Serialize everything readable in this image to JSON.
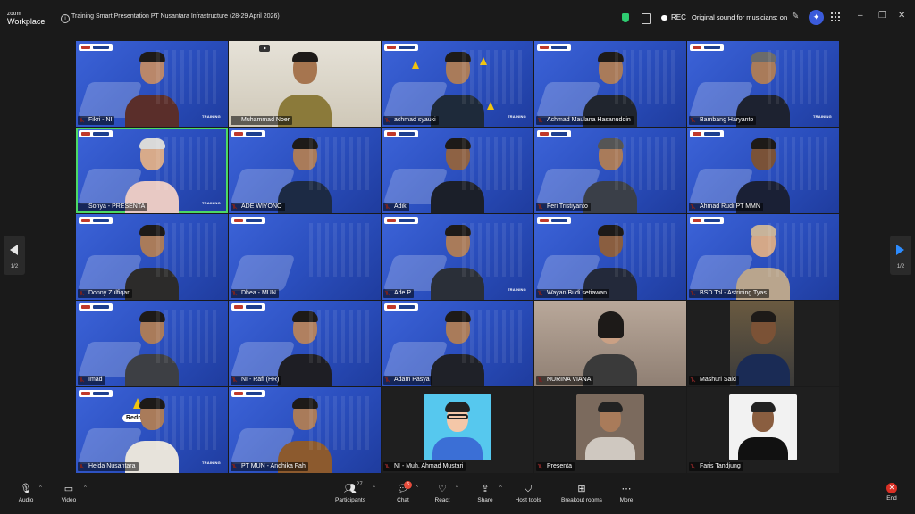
{
  "app": {
    "logo_line1": "zoom",
    "logo_line2": "Workplace",
    "meeting_title": "Training Smart Presentation PT Nusantara Infrastructure (28-29 April 2026)"
  },
  "topbar": {
    "rec_label": "REC",
    "original_sound": "Original sound for musicians: on"
  },
  "gallery": {
    "page_indicator": "1/2",
    "training_label": "TRAINING",
    "redmi_label": "Redmi N...",
    "participants": [
      {
        "name": "Fikri - NI"
      },
      {
        "name": "Muhammad Noer"
      },
      {
        "name": "achmad syauki"
      },
      {
        "name": "Achmad Maulana Hasanuddin"
      },
      {
        "name": "Bambang Haryanto"
      },
      {
        "name": "Sonya - PRESENTA"
      },
      {
        "name": "ADE WIYONO"
      },
      {
        "name": "Adik"
      },
      {
        "name": "Feri Tristiyanto"
      },
      {
        "name": "Ahmad Rudi PT MMN"
      },
      {
        "name": "Donny Zulfiqar"
      },
      {
        "name": "Dhea - MUN"
      },
      {
        "name": "Ade P"
      },
      {
        "name": "Wayan Budi setiawan"
      },
      {
        "name": "BSD Tol - Astrining Tyas"
      },
      {
        "name": "Imad"
      },
      {
        "name": "NI - Rafi (HR)"
      },
      {
        "name": "Adam Pasya"
      },
      {
        "name": "NURINA VIANA"
      },
      {
        "name": "Mashuri Said"
      },
      {
        "name": "Helda Nusantara"
      },
      {
        "name": "PT MUN - Andhika Fah"
      },
      {
        "name": "NI - Muh. Ahmad Mustari"
      },
      {
        "name": "Presenta"
      },
      {
        "name": "Faris Tandjung"
      }
    ]
  },
  "toolbar": {
    "audio": "Audio",
    "video": "Video",
    "participants": "Participants",
    "participant_count": "27",
    "chat": "Chat",
    "chat_badge": "6",
    "react": "React",
    "share": "Share",
    "host_tools": "Host tools",
    "breakout_rooms": "Breakout rooms",
    "more": "More",
    "end": "End"
  },
  "colors": {
    "accent_green": "#4cd964",
    "end_red": "#d93025",
    "bg_blue": "#2a4fc8"
  }
}
